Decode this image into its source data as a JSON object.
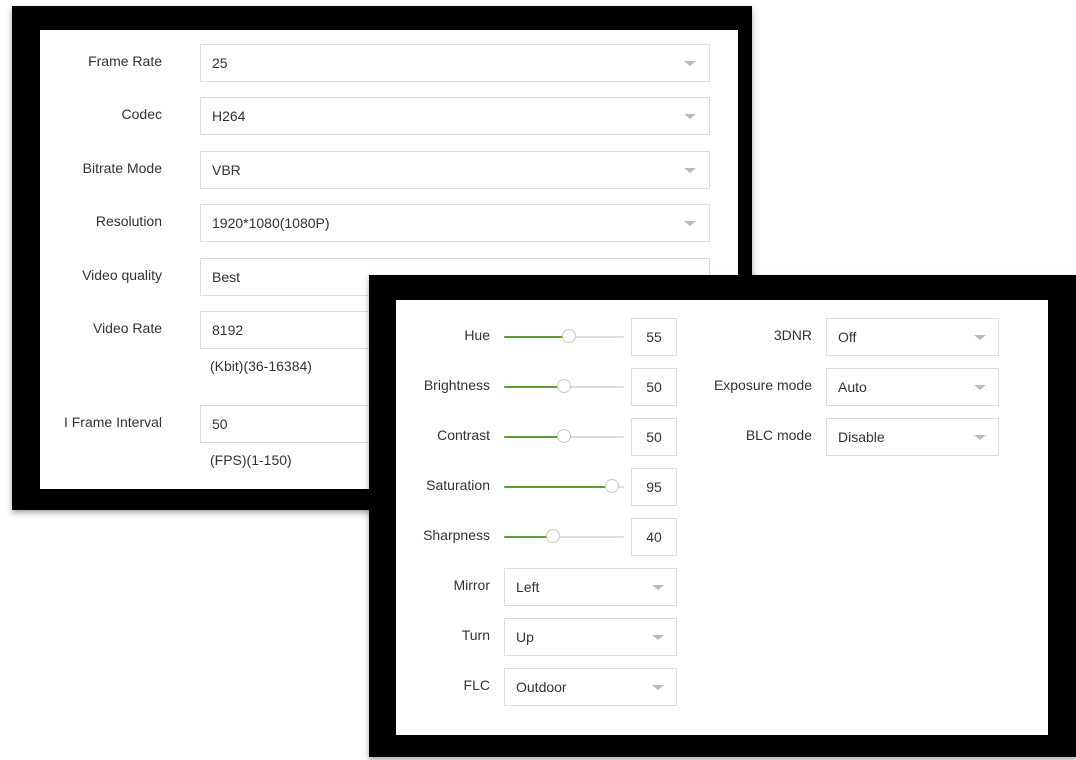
{
  "video_panel": {
    "frame_rate": {
      "label": "Frame Rate",
      "value": "25"
    },
    "codec": {
      "label": "Codec",
      "value": "H264"
    },
    "bitrate_mode": {
      "label": "Bitrate Mode",
      "value": "VBR"
    },
    "resolution": {
      "label": "Resolution",
      "value": "1920*1080(1080P)"
    },
    "video_quality": {
      "label": "Video quality",
      "value": "Best"
    },
    "video_rate": {
      "label": "Video Rate",
      "value": "8192",
      "hint": "(Kbit)(36-16384)"
    },
    "i_frame_interval": {
      "label": "I Frame Interval",
      "value": "50",
      "hint": "(FPS)(1-150)"
    }
  },
  "image_panel": {
    "hue": {
      "label": "Hue",
      "value": "55",
      "level": 0.55
    },
    "brightness": {
      "label": "Brightness",
      "value": "50",
      "level": 0.5
    },
    "contrast": {
      "label": "Contrast",
      "value": "50",
      "level": 0.5
    },
    "saturation": {
      "label": "Saturation",
      "value": "95",
      "level": 0.95
    },
    "sharpness": {
      "label": "Sharpness",
      "value": "40",
      "level": 0.4
    },
    "mirror": {
      "label": "Mirror",
      "value": "Left"
    },
    "turn": {
      "label": "Turn",
      "value": "Up"
    },
    "flc": {
      "label": "FLC",
      "value": "Outdoor"
    },
    "dnr": {
      "label": "3DNR",
      "value": "Off"
    },
    "exposure_mode": {
      "label": "Exposure mode",
      "value": "Auto"
    },
    "blc_mode": {
      "label": "BLC mode",
      "value": "Disable"
    }
  },
  "colors": {
    "slider_fill": "#5a9e33",
    "slider_track": "#dddddd",
    "frame": "#000000"
  }
}
